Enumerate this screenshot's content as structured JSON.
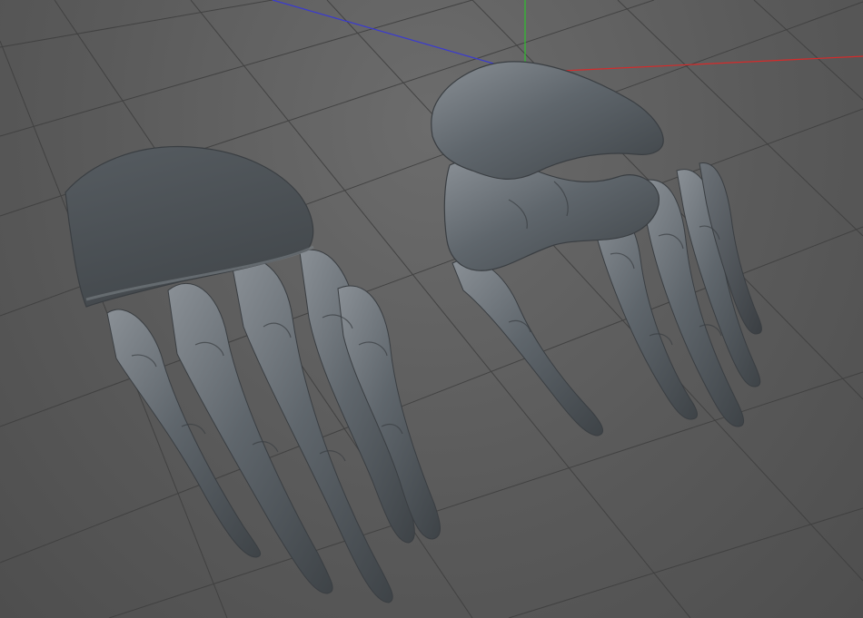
{
  "viewport": {
    "background_color": "#5a5a5a",
    "grid_color": "#3f3f3f",
    "axes": [
      {
        "name": "x",
        "color": "#d62a2a"
      },
      {
        "name": "y",
        "color": "#2fbf2f"
      },
      {
        "name": "z",
        "color": "#3a3ad0"
      }
    ],
    "objects": [
      {
        "name": "left-skeletal-hand",
        "material_color": "#5f666c"
      },
      {
        "name": "right-skeletal-hand",
        "material_color": "#5f666c"
      }
    ]
  }
}
